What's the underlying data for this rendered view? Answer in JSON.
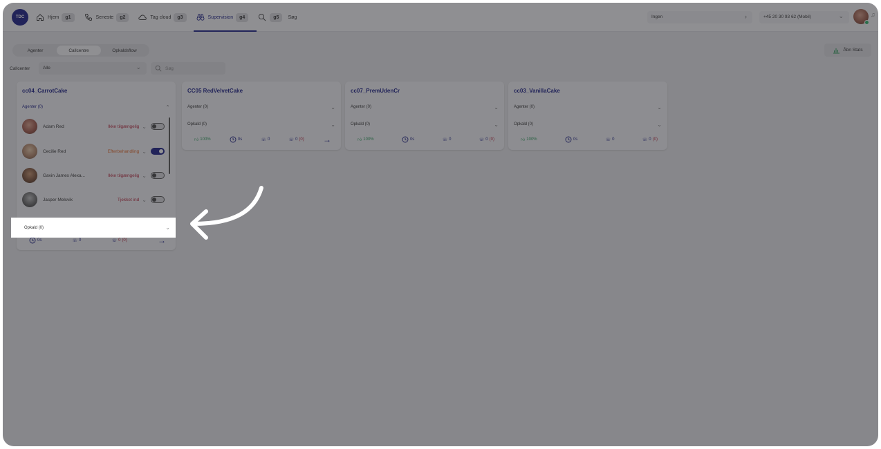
{
  "topbar": {
    "logo": "TDC",
    "nav": [
      {
        "label": "Hjem",
        "key": "g1",
        "icon": "home-icon"
      },
      {
        "label": "Seneste",
        "key": "g2",
        "icon": "phone-icon"
      },
      {
        "label": "Tag cloud",
        "key": "g3",
        "icon": "cloud-icon"
      },
      {
        "label": "Supervision",
        "key": "g4",
        "icon": "binoculars-icon",
        "active": true
      },
      {
        "label": "Søg",
        "key": "g5",
        "icon": "search-icon"
      }
    ],
    "queue_select": "Ingen",
    "phone_select": "+45 20 30 93 62 (Mobil)"
  },
  "filters": {
    "tabs": [
      "Agenter",
      "Callcentre",
      "Opkaldsflow"
    ],
    "active_tab": "Callcentre",
    "callcenter_label": "Callcenter",
    "callcenter_value": "Alle",
    "search_placeholder": "Søg",
    "open_stats": "Åbn Stats"
  },
  "cards": [
    {
      "title": "cc04_CarrotCake",
      "agents_label": "Agenter (0)",
      "calls_label": "Opkald (0)",
      "agents": [
        {
          "name": "Adam Red",
          "status": "Ikke tilgængelig",
          "status_color": "#b8283f",
          "on": false
        },
        {
          "name": "Cecilie Red",
          "status": "Efterbehandling",
          "status_color": "#e26a2c",
          "on": true
        },
        {
          "name": "Gavin James Alexa...",
          "status": "Ikke tilgængelig",
          "status_color": "#b8283f",
          "on": false
        },
        {
          "name": "Jasper Melsvik",
          "status": "Tjekket ind",
          "status_color": "#b8283f",
          "on": false
        }
      ],
      "stats": {
        "time": "0s",
        "calls": "0",
        "missed": "0",
        "missed_extra": "(0)"
      }
    },
    {
      "title": "CC05 RedVelvetCake",
      "agents_label": "Agenter (0)",
      "calls_label": "Opkald (0)",
      "stats": {
        "rate": "100%",
        "time": "0s",
        "calls": "0",
        "missed": "0",
        "missed_extra": "(0)"
      }
    },
    {
      "title": "cc07_PremUdenCr",
      "agents_label": "Agenter (0)",
      "calls_label": "Opkald (0)",
      "stats": {
        "rate": "100%",
        "time": "0s",
        "calls": "0",
        "missed": "0",
        "missed_extra": "(0)"
      }
    },
    {
      "title": "cc03_VanillaCake",
      "agents_label": "Agenter (0)",
      "calls_label": "Opkald (0)",
      "stats": {
        "rate": "100%",
        "time": "0s",
        "calls": "0",
        "missed": "0",
        "missed_extra": "(0)"
      }
    }
  ],
  "colors": {
    "brand": "#1b1f86",
    "danger": "#b8283f",
    "warning": "#e26a2c",
    "success": "#2a9b5a"
  }
}
